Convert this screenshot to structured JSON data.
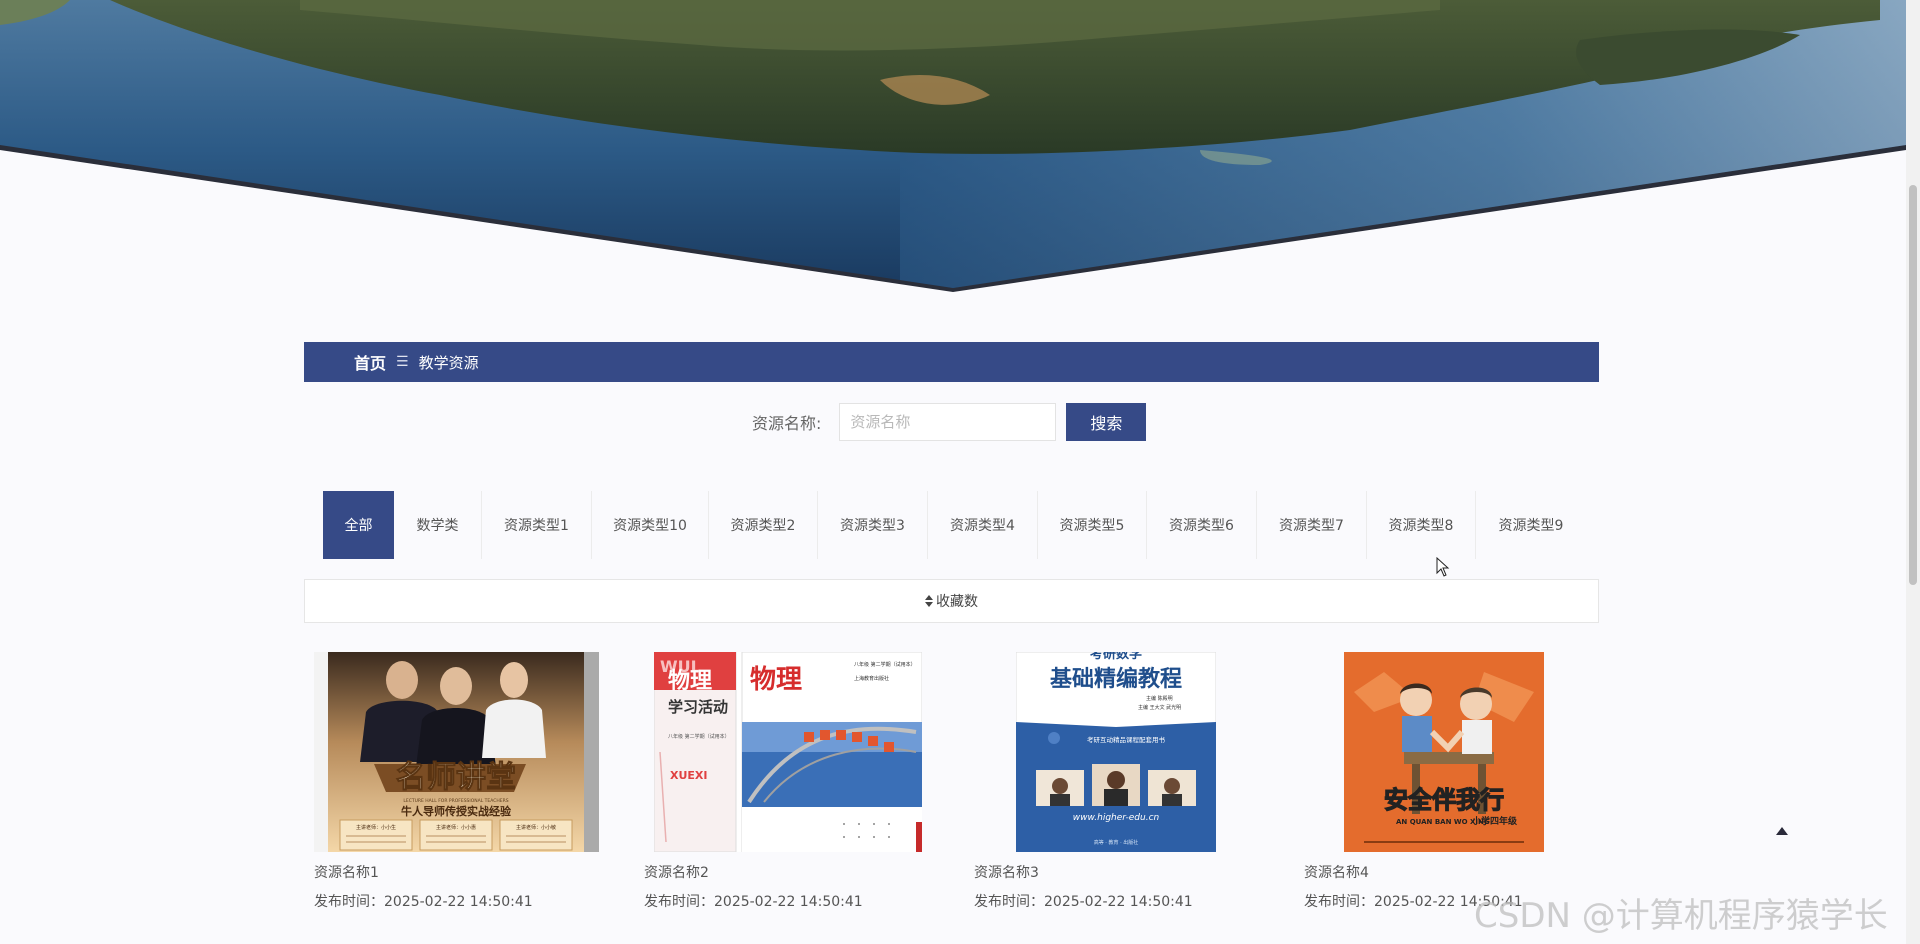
{
  "breadcrumb": {
    "home": "首页",
    "separator": "☰",
    "current": "教学资源"
  },
  "search": {
    "label": "资源名称:",
    "placeholder": "资源名称",
    "value": "",
    "button": "搜索"
  },
  "tabs": [
    {
      "label": "全部",
      "active": true
    },
    {
      "label": "数学类"
    },
    {
      "label": "资源类型1"
    },
    {
      "label": "资源类型10"
    },
    {
      "label": "资源类型2"
    },
    {
      "label": "资源类型3"
    },
    {
      "label": "资源类型4"
    },
    {
      "label": "资源类型5"
    },
    {
      "label": "资源类型6"
    },
    {
      "label": "资源类型7"
    },
    {
      "label": "资源类型8"
    },
    {
      "label": "资源类型9"
    }
  ],
  "sort": {
    "label": "收藏数",
    "icon": "sort-icon"
  },
  "resources": [
    {
      "name": "资源名称1",
      "time": "发布时间：2025-02-22 14:50:41",
      "cover": {
        "title": "名师讲堂",
        "subtitle": "牛人导师传授实战经验",
        "small": "LECTURE HALL FOR PROFESSIONAL TEACHERS",
        "teachers": [
          "主讲老师：小小生",
          "主讲老师：小小惠",
          "主讲老师：小小敏"
        ]
      }
    },
    {
      "name": "资源名称2",
      "time": "发布时间：2025-02-22 14:50:41",
      "cover": {
        "title_left": "物理",
        "title_right": "物理",
        "top_left": "WUL",
        "activity": "学习活动",
        "grade": "八年级 第二学期（试用本）",
        "grade_right": "八年级 第二学期（试用本）",
        "publisher": "上海教育出版社",
        "xuexi": "XUEXI"
      }
    },
    {
      "name": "资源名称3",
      "time": "发布时间：2025-02-22 14:50:41",
      "cover": {
        "top": "考研数学",
        "title": "基础精编教程",
        "editors": "主编 陈殿明",
        "authors": "主编 王大文 武光明",
        "series": "考研互动精品课程配套用书",
        "website": "www.higher-edu.cn",
        "footer": "高等 · 教育 · 出版社"
      }
    },
    {
      "name": "资源名称4",
      "time": "发布时间：2025-02-22 14:50:41",
      "cover": {
        "title": "安全伴我行",
        "grade": "小学四年级",
        "pinyin": "AN QUAN BAN WO XING"
      }
    }
  ],
  "watermark": "CSDN @计算机程序猿学长",
  "colors": {
    "primary": "#364a87",
    "background": "#fafafd"
  }
}
